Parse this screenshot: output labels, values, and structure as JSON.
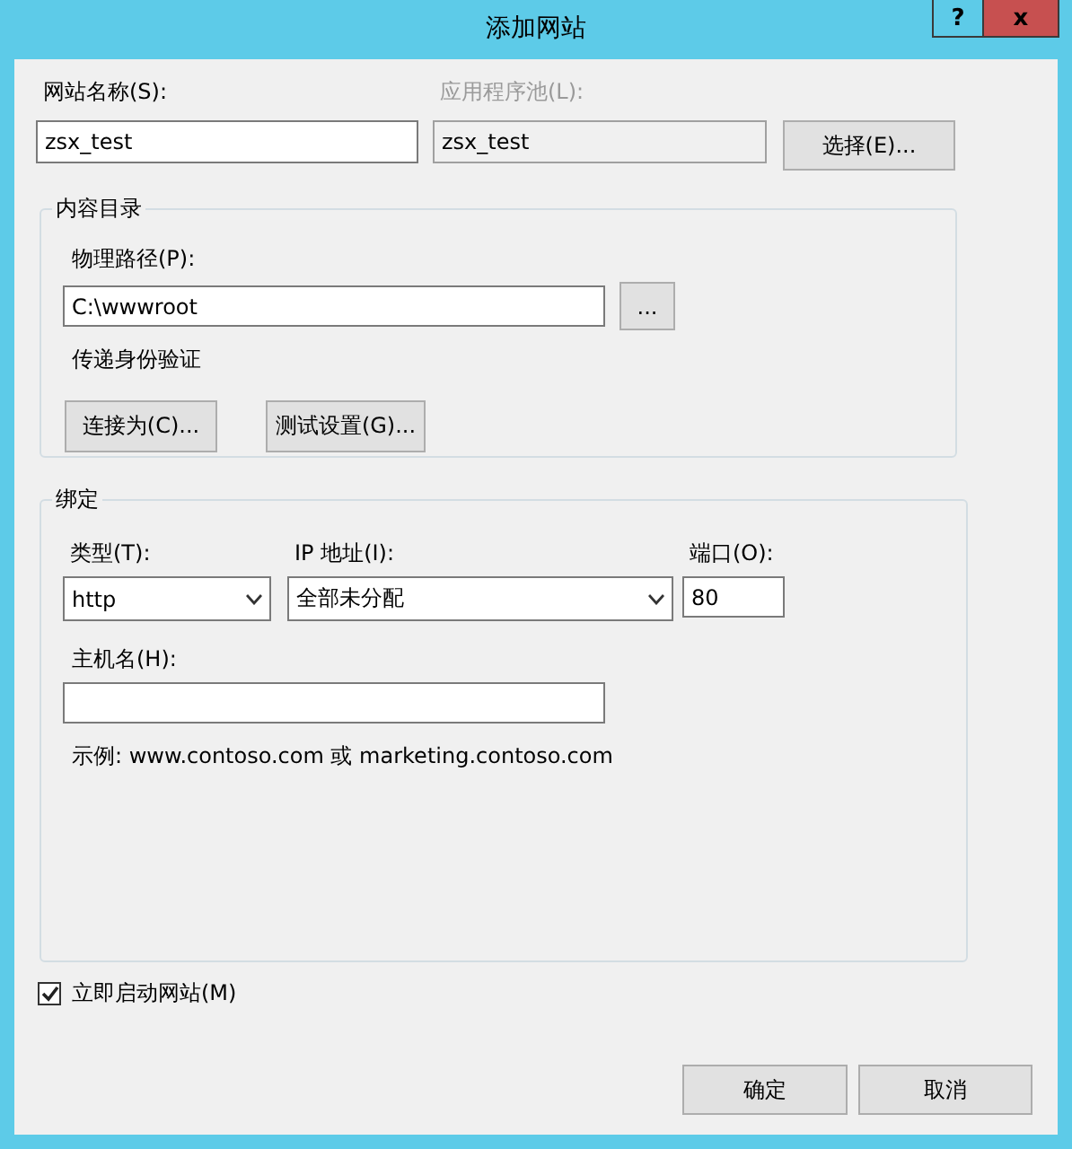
{
  "window": {
    "title": "添加网站",
    "buttons": [
      {
        "kind": "help",
        "label": "?"
      },
      {
        "kind": "close",
        "label": "x"
      }
    ]
  },
  "site_name": {
    "label": "网站名称(S):",
    "value": "zsx_test"
  },
  "app_pool": {
    "label": "应用程序池(L):",
    "value": "zsx_test",
    "disabled": true,
    "button": "选择(E)..."
  },
  "content_directory": {
    "title": "内容目录",
    "physical_path": {
      "label": "物理路径(P):",
      "value": "C:\\wwwroot",
      "browse_button": "..."
    },
    "pass_through_auth": "传递身份验证",
    "buttons": [
      "连接为(C)...",
      "测试设置(G)..."
    ]
  },
  "binding": {
    "title": "绑定",
    "type": {
      "label": "类型(T):",
      "value": "http"
    },
    "ip_address": {
      "label": "IP 地址(I):",
      "value": "全部未分配"
    },
    "port": {
      "label": "端口(O):",
      "value": "80"
    },
    "host_name": {
      "label": "主机名(H):"
    },
    "example": "示例: www.contoso.com 或 marketing.contoso.com"
  },
  "start_now": {
    "label": "立即启动网站(M)",
    "checked": true
  },
  "buttons": [
    "确定",
    "取消"
  ]
}
